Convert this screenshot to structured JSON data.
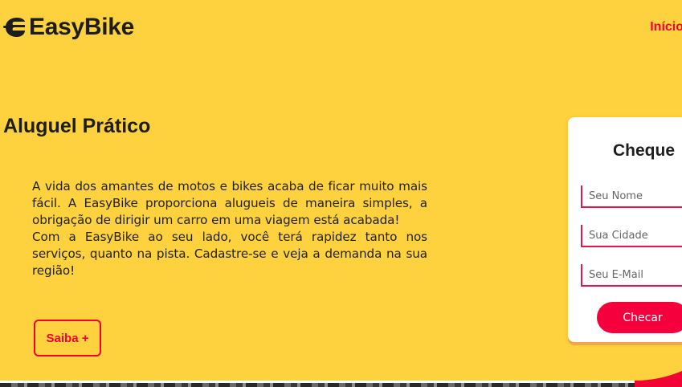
{
  "header": {
    "logo_text": "EasyBike",
    "logo_icon": "helmet-icon",
    "nav": {
      "inicio_label": "Início"
    }
  },
  "hero": {
    "title": "Aluguel Prático",
    "paragraph1": "A vida dos amantes de motos e bikes acaba de ficar muito mais fácil. A EasyBike proporciona alugueis de maneira simples, a obrigação de dirigir um carro em uma viagem está acabada!",
    "paragraph2": "Com a EasyBike ao seu lado, você terá rapidez tanto nos serviços, quanto na pista. Cadastre-se e veja a demanda na sua região!",
    "button_label": "Saiba +"
  },
  "form": {
    "title": "Cheque",
    "name_placeholder": "Seu Nome",
    "city_placeholder": "Sua Cidade",
    "email_placeholder": "Seu E-Mail",
    "submit_label": "Checar"
  },
  "colors": {
    "background": "#fed13e",
    "accent": "#f10434",
    "text": "#1d1d1d"
  }
}
